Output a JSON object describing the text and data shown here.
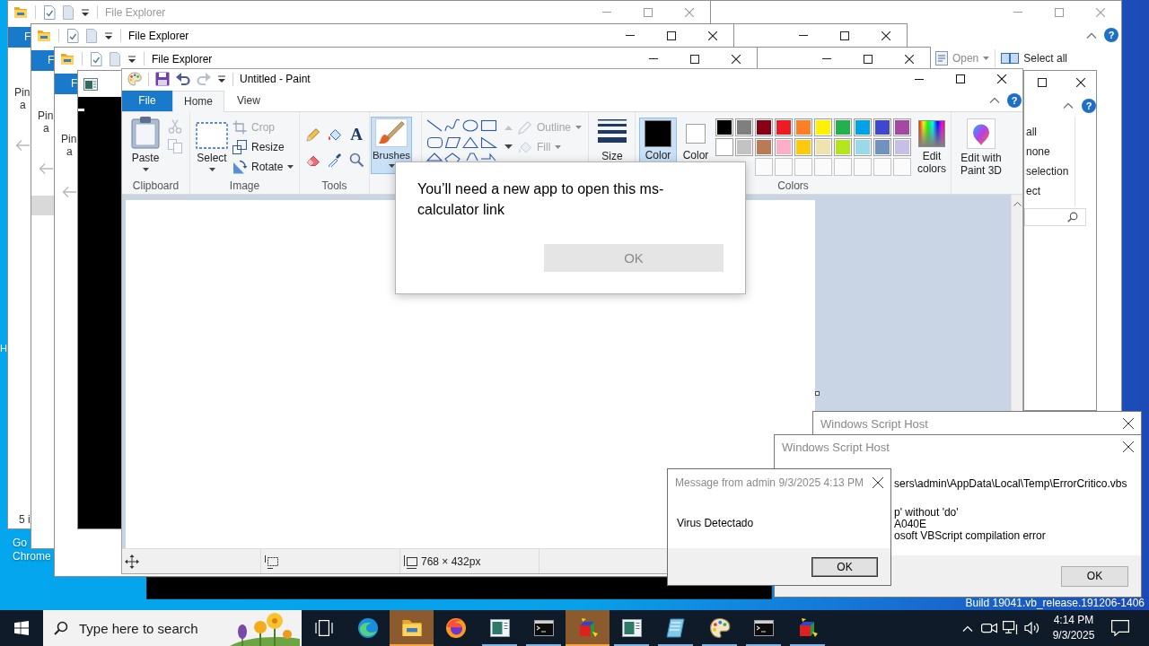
{
  "desktop": {
    "edge_label": "H",
    "shortcut_label": [
      "Go",
      "Chrome"
    ],
    "build_text": "Build 19041.vb_release.191206-1406"
  },
  "explorer_back": {
    "help": "?",
    "ribbon_buttons": [
      {
        "kind": "open",
        "label": "Open",
        "dropdown": true,
        "disabled": true
      },
      {
        "kind": "select-all",
        "label": "Select all",
        "dropdown": false,
        "disabled": false
      }
    ]
  },
  "explorer_windows": [
    {
      "title": "File Explorer",
      "inactive": true,
      "file_tab": "F",
      "pin_button": [
        "Pin",
        "a"
      ],
      "nav_selected": false
    },
    {
      "title": "File Explorer",
      "inactive": false,
      "file_tab": "F",
      "pin_button": [
        "Pin",
        "a"
      ],
      "nav_selected": true
    },
    {
      "title": "File Explorer",
      "inactive": false,
      "file_tab": "F",
      "pin_button": [
        "Pin",
        "a"
      ],
      "nav_selected": false
    }
  ],
  "explorer_status": "5 i",
  "explorer_front": {
    "help": "?",
    "ribbon_buttons": [
      "all",
      "none",
      "selection",
      "ect"
    ]
  },
  "paint": {
    "title": "Untitled - Paint",
    "tabs": [
      {
        "label": "File",
        "kind": "menu",
        "selected": false
      },
      {
        "label": "Home",
        "kind": "tab",
        "selected": true
      },
      {
        "label": "View",
        "kind": "tab",
        "selected": false
      }
    ],
    "help": "?",
    "clipboard": {
      "label": "Clipboard",
      "paste": "Paste",
      "tools": [
        {
          "kind": "cut",
          "disabled": true
        },
        {
          "kind": "copy",
          "disabled": true
        }
      ]
    },
    "image": {
      "label": "Image",
      "select": "Select",
      "actions": [
        {
          "kind": "crop",
          "label": "Crop",
          "disabled": true,
          "dropdown": false
        },
        {
          "kind": "resize",
          "label": "Resize",
          "disabled": false,
          "dropdown": false
        },
        {
          "kind": "rotate",
          "label": "Rotate",
          "disabled": false,
          "dropdown": true
        }
      ]
    },
    "tools": {
      "label": "Tools",
      "items": [
        {
          "kind": "pencil",
          "selected": false
        },
        {
          "kind": "fill",
          "selected": false
        },
        {
          "kind": "text",
          "glyph": "A",
          "selected": false
        },
        {
          "kind": "eraser",
          "selected": false
        },
        {
          "kind": "picker",
          "selected": false
        },
        {
          "kind": "magnifier",
          "selected": false
        }
      ]
    },
    "brushes": {
      "label": "Brushes",
      "selected": true
    },
    "shapes": {
      "options": [
        {
          "kind": "outline",
          "label": "Outline",
          "disabled": true,
          "dropdown": true
        },
        {
          "kind": "fill",
          "label": "Fill",
          "disabled": true,
          "dropdown": true
        }
      ]
    },
    "size": {
      "label": "Size"
    },
    "colors": {
      "label": "Colors",
      "slots": [
        {
          "label": "Color",
          "color": "#000000",
          "selected": true
        },
        {
          "label": "Color",
          "color": "#ffffff",
          "selected": false
        }
      ],
      "palette": [
        {
          "kind": "swatch",
          "color": "#000000"
        },
        {
          "kind": "swatch",
          "color": "#7f7f7f"
        },
        {
          "kind": "swatch",
          "color": "#880015"
        },
        {
          "kind": "swatch",
          "color": "#ed1c24"
        },
        {
          "kind": "swatch",
          "color": "#ff7f27"
        },
        {
          "kind": "swatch",
          "color": "#fff200"
        },
        {
          "kind": "swatch",
          "color": "#22b14c"
        },
        {
          "kind": "swatch",
          "color": "#00a2e8"
        },
        {
          "kind": "swatch",
          "color": "#3f48cc"
        },
        {
          "kind": "swatch",
          "color": "#a349a4"
        },
        {
          "kind": "swatch",
          "color": "#ffffff"
        },
        {
          "kind": "swatch",
          "color": "#c3c3c3"
        },
        {
          "kind": "swatch",
          "color": "#b97a57"
        },
        {
          "kind": "swatch",
          "color": "#ffaec9"
        },
        {
          "kind": "swatch",
          "color": "#ffc90e"
        },
        {
          "kind": "swatch",
          "color": "#efe4b0"
        },
        {
          "kind": "swatch",
          "color": "#b5e61d"
        },
        {
          "kind": "swatch",
          "color": "#99d9ea"
        },
        {
          "kind": "swatch",
          "color": "#7092be"
        },
        {
          "kind": "swatch",
          "color": "#c8bfe7"
        },
        {
          "kind": "empty"
        },
        {
          "kind": "empty"
        },
        {
          "kind": "empty"
        },
        {
          "kind": "empty"
        },
        {
          "kind": "empty"
        },
        {
          "kind": "empty"
        },
        {
          "kind": "empty"
        },
        {
          "kind": "empty"
        }
      ],
      "edit": "Edit colors"
    },
    "paint3d": "Edit with Paint 3D",
    "status": {
      "canvas_size": "768 × 432px"
    }
  },
  "app_dialog": {
    "message": "You’ll need a new app to open this ms-calculator link",
    "button": "OK"
  },
  "script_host_windows": [
    {
      "title": "Windows Script Host"
    },
    {
      "title": "Windows Script Host",
      "blocks": [
        [
          "sers\\admin\\AppData\\Local\\Temp\\ErrorCritico.vbs"
        ],
        [
          "p' without 'do'",
          "A040E",
          "osoft VBScript compilation error"
        ]
      ],
      "button": "OK"
    }
  ],
  "message_box": {
    "title": "Message from admin 9/3/2025 4:13 PM",
    "message": "Virus Detectado",
    "button": "OK"
  },
  "taskbar": {
    "search": {
      "placeholder": "Type here to search"
    },
    "apps": [
      {
        "kind": "taskview",
        "running": false,
        "flashing": false
      },
      {
        "kind": "edge",
        "running": false,
        "flashing": false
      },
      {
        "kind": "explorer",
        "running": true,
        "flashing": true
      },
      {
        "kind": "firefox",
        "running": false,
        "flashing": false
      },
      {
        "kind": "window",
        "running": true,
        "flashing": false
      },
      {
        "kind": "terminal",
        "running": true,
        "flashing": false
      },
      {
        "kind": "cubes",
        "running": true,
        "flashing": true
      },
      {
        "kind": "window",
        "running": true,
        "flashing": false
      },
      {
        "kind": "notepad",
        "running": true,
        "flashing": false
      },
      {
        "kind": "paint",
        "running": true,
        "flashing": false
      },
      {
        "kind": "terminal",
        "running": true,
        "flashing": false
      },
      {
        "kind": "cubes",
        "running": true,
        "flashing": false
      }
    ],
    "clock": {
      "time": "4:14 PM",
      "date": "9/3/2025"
    }
  }
}
